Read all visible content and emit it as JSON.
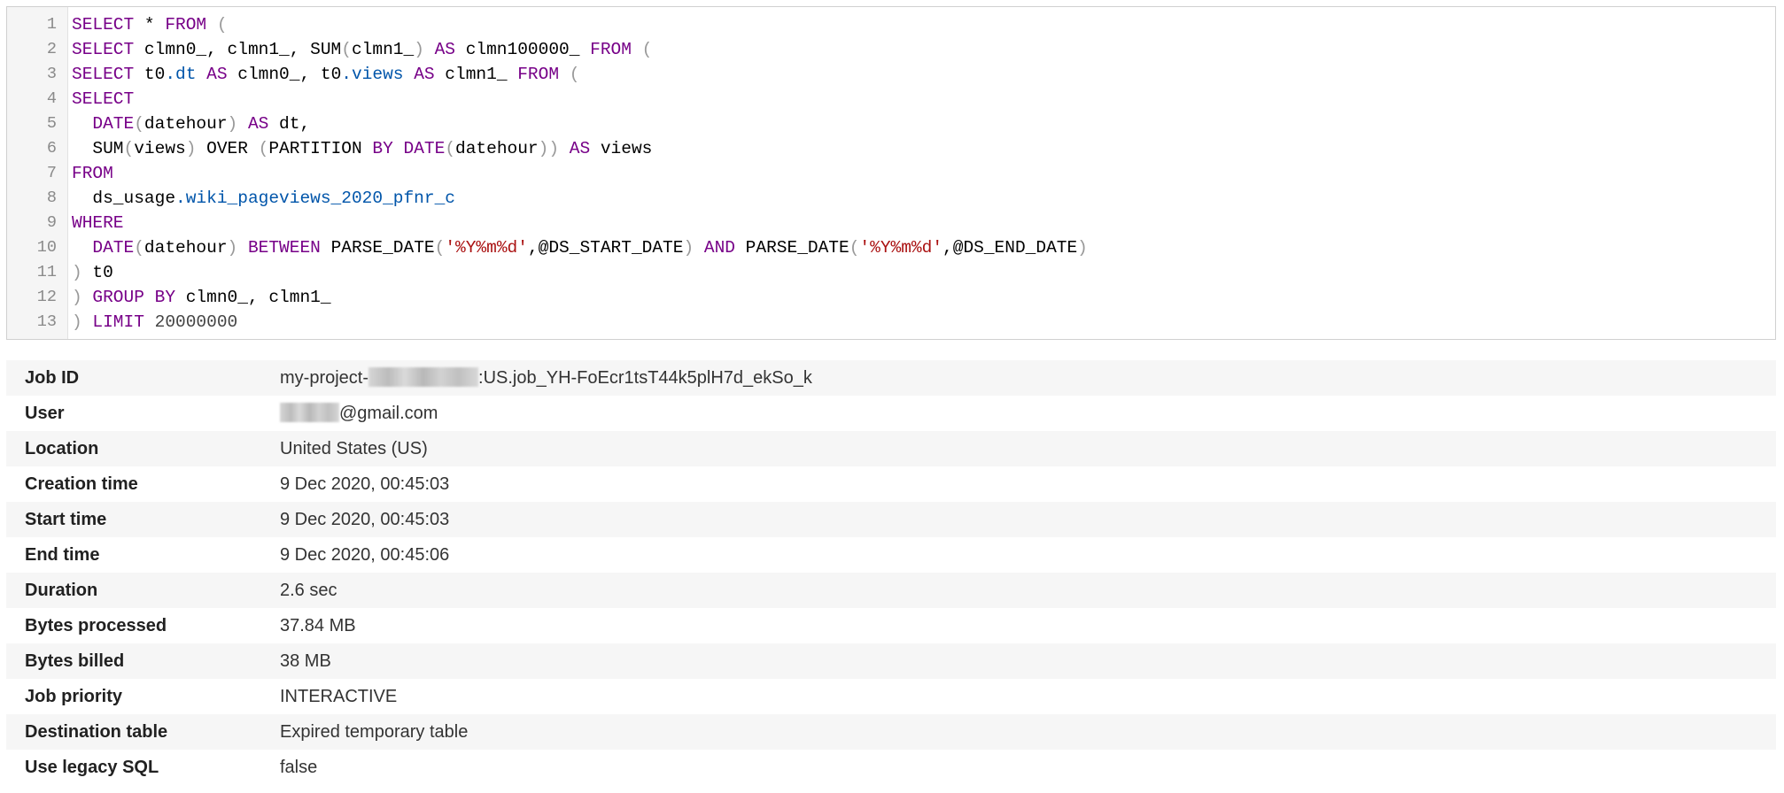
{
  "query": {
    "lines": [
      {
        "num": "1",
        "tokens": [
          [
            "kw",
            "SELECT"
          ],
          [
            "plain",
            " * "
          ],
          [
            "kw",
            "FROM"
          ],
          [
            "plain",
            " "
          ],
          [
            "br",
            "("
          ]
        ]
      },
      {
        "num": "2",
        "tokens": [
          [
            "kw",
            "SELECT"
          ],
          [
            "plain",
            " clmn0_, clmn1_, SUM"
          ],
          [
            "br",
            "("
          ],
          [
            "plain",
            "clmn1_"
          ],
          [
            "br",
            ")"
          ],
          [
            "plain",
            " "
          ],
          [
            "kw",
            "AS"
          ],
          [
            "plain",
            " clmn100000_ "
          ],
          [
            "kw",
            "FROM"
          ],
          [
            "plain",
            " "
          ],
          [
            "br",
            "("
          ]
        ]
      },
      {
        "num": "3",
        "tokens": [
          [
            "kw",
            "SELECT"
          ],
          [
            "plain",
            " t0"
          ],
          [
            "var",
            ".dt"
          ],
          [
            "plain",
            " "
          ],
          [
            "kw",
            "AS"
          ],
          [
            "plain",
            " clmn0_, t0"
          ],
          [
            "var",
            ".views"
          ],
          [
            "plain",
            " "
          ],
          [
            "kw",
            "AS"
          ],
          [
            "plain",
            " clmn1_ "
          ],
          [
            "kw",
            "FROM"
          ],
          [
            "plain",
            " "
          ],
          [
            "br",
            "("
          ]
        ]
      },
      {
        "num": "4",
        "tokens": [
          [
            "kw",
            "SELECT"
          ]
        ]
      },
      {
        "num": "5",
        "tokens": [
          [
            "plain",
            "  "
          ],
          [
            "fn",
            "DATE"
          ],
          [
            "br",
            "("
          ],
          [
            "plain",
            "datehour"
          ],
          [
            "br",
            ")"
          ],
          [
            "plain",
            " "
          ],
          [
            "kw",
            "AS"
          ],
          [
            "plain",
            " dt,"
          ]
        ]
      },
      {
        "num": "6",
        "tokens": [
          [
            "plain",
            "  SUM"
          ],
          [
            "br",
            "("
          ],
          [
            "plain",
            "views"
          ],
          [
            "br",
            ")"
          ],
          [
            "plain",
            " OVER "
          ],
          [
            "br",
            "("
          ],
          [
            "plain",
            "PARTITION "
          ],
          [
            "kw",
            "BY"
          ],
          [
            "plain",
            " "
          ],
          [
            "fn",
            "DATE"
          ],
          [
            "br",
            "("
          ],
          [
            "plain",
            "datehour"
          ],
          [
            "br",
            "))"
          ],
          [
            "plain",
            " "
          ],
          [
            "kw",
            "AS"
          ],
          [
            "plain",
            " views"
          ]
        ]
      },
      {
        "num": "7",
        "tokens": [
          [
            "kw",
            "FROM"
          ]
        ]
      },
      {
        "num": "8",
        "tokens": [
          [
            "plain",
            "  ds_usage"
          ],
          [
            "var",
            ".wiki_pageviews_2020_pfnr_c"
          ]
        ]
      },
      {
        "num": "9",
        "tokens": [
          [
            "kw",
            "WHERE"
          ]
        ]
      },
      {
        "num": "10",
        "tokens": [
          [
            "plain",
            "  "
          ],
          [
            "fn",
            "DATE"
          ],
          [
            "br",
            "("
          ],
          [
            "plain",
            "datehour"
          ],
          [
            "br",
            ")"
          ],
          [
            "plain",
            " "
          ],
          [
            "kw",
            "BETWEEN"
          ],
          [
            "plain",
            " PARSE_DATE"
          ],
          [
            "br",
            "("
          ],
          [
            "str",
            "'%Y%m%d'"
          ],
          [
            "plain",
            ",@DS_START_DATE"
          ],
          [
            "br",
            ")"
          ],
          [
            "plain",
            " "
          ],
          [
            "kw",
            "AND"
          ],
          [
            "plain",
            " PARSE_DATE"
          ],
          [
            "br",
            "("
          ],
          [
            "str",
            "'%Y%m%d'"
          ],
          [
            "plain",
            ",@DS_END_DATE"
          ],
          [
            "br",
            ")"
          ]
        ]
      },
      {
        "num": "11",
        "tokens": [
          [
            "br",
            ")"
          ],
          [
            "plain",
            " t0"
          ]
        ]
      },
      {
        "num": "12",
        "tokens": [
          [
            "br",
            ")"
          ],
          [
            "plain",
            " "
          ],
          [
            "kw",
            "GROUP"
          ],
          [
            "plain",
            " "
          ],
          [
            "kw",
            "BY"
          ],
          [
            "plain",
            " clmn0_, clmn1_"
          ]
        ]
      },
      {
        "num": "13",
        "tokens": [
          [
            "br",
            ")"
          ],
          [
            "plain",
            " "
          ],
          [
            "kw",
            "LIMIT"
          ],
          [
            "plain",
            " "
          ],
          [
            "num2",
            "20000000"
          ]
        ]
      }
    ]
  },
  "job_details": {
    "job_id": {
      "label": "Job ID",
      "value_prefix": "my-project-",
      "value_suffix": ":US.job_YH-FoEcr1tsT44k5plH7d_ekSo_k"
    },
    "user": {
      "label": "User",
      "value_suffix": "@gmail.com"
    },
    "location": {
      "label": "Location",
      "value": "United States (US)"
    },
    "creation_time": {
      "label": "Creation time",
      "value": "9 Dec 2020, 00:45:03"
    },
    "start_time": {
      "label": "Start time",
      "value": "9 Dec 2020, 00:45:03"
    },
    "end_time": {
      "label": "End time",
      "value": "9 Dec 2020, 00:45:06"
    },
    "duration": {
      "label": "Duration",
      "value": "2.6 sec"
    },
    "bytes_processed": {
      "label": "Bytes processed",
      "value": "37.84 MB"
    },
    "bytes_billed": {
      "label": "Bytes billed",
      "value": "38 MB"
    },
    "job_priority": {
      "label": "Job priority",
      "value": "INTERACTIVE"
    },
    "destination_table": {
      "label": "Destination table",
      "value": "Expired temporary table"
    },
    "use_legacy_sql": {
      "label": "Use legacy SQL",
      "value": "false"
    }
  },
  "colors": {
    "keyword": "#770088",
    "variable": "#0055aa",
    "string": "#aa1111",
    "bracket": "#999999",
    "row_shade": "#f6f6f6"
  }
}
